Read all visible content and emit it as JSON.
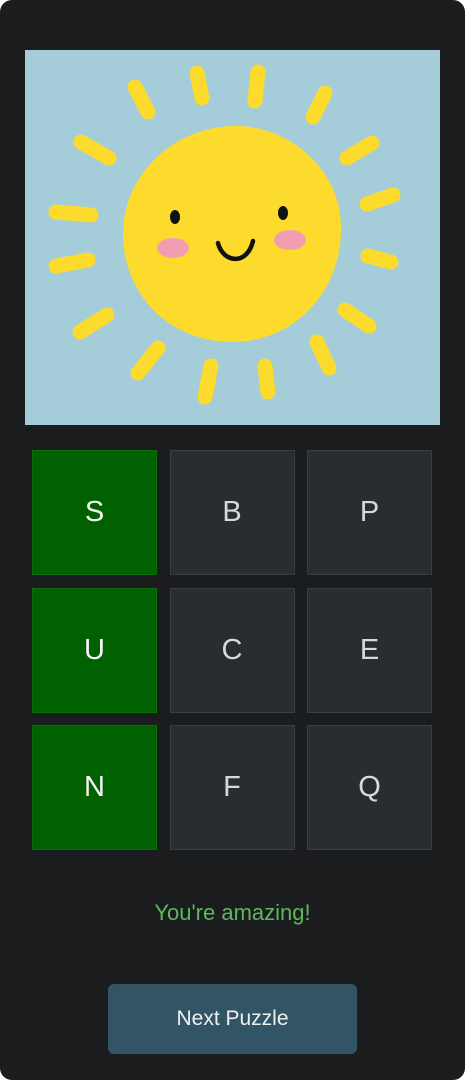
{
  "puzzle": {
    "image_icon": "smiling-sun-icon",
    "grid_rows": [
      [
        {
          "letter": "S",
          "state": "correct"
        },
        {
          "letter": "B",
          "state": "neutral"
        },
        {
          "letter": "P",
          "state": "neutral"
        }
      ],
      [
        {
          "letter": "U",
          "state": "correct"
        },
        {
          "letter": "C",
          "state": "neutral"
        },
        {
          "letter": "E",
          "state": "neutral"
        }
      ],
      [
        {
          "letter": "N",
          "state": "correct"
        },
        {
          "letter": "F",
          "state": "neutral"
        },
        {
          "letter": "Q",
          "state": "neutral"
        }
      ]
    ]
  },
  "feedback": {
    "message": "You're amazing!"
  },
  "actions": {
    "next_label": "Next Puzzle"
  },
  "colors": {
    "card_background": "#1b1c1e",
    "picture_background": "#a4cdd9",
    "sun_yellow": "#fcdb2c",
    "tile_neutral": "#292c30",
    "tile_correct": "#006100",
    "message_green": "#5cb85c",
    "button_background": "#325566"
  }
}
